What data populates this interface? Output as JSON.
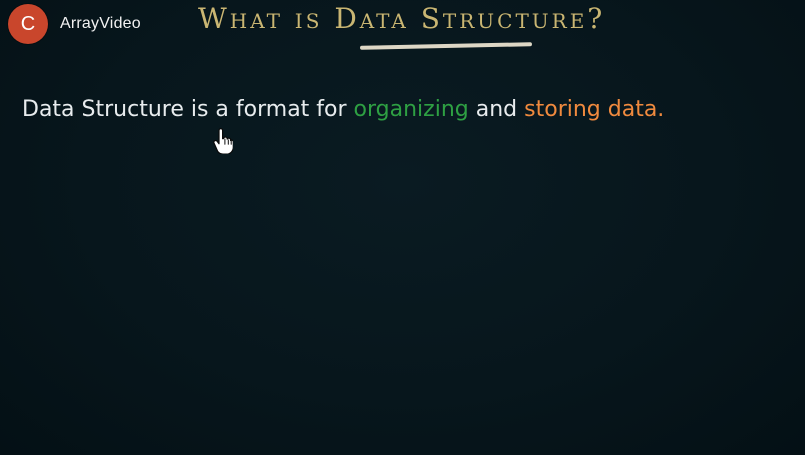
{
  "channel": {
    "avatar_letter": "C",
    "title": "ArrayVideo",
    "avatar_color": "#c9462c"
  },
  "slide": {
    "title": "What is Data Structure?",
    "definition": {
      "part1": "Data Structure is a format for ",
      "highlight1": "organizing",
      "part2": " and ",
      "highlight2": "storing data."
    },
    "colors": {
      "title": "#c9b673",
      "highlight1": "#2ea043",
      "highlight2": "#f08a3e",
      "background": "#06141a"
    }
  },
  "icons": {
    "cursor": "hand-pointer-icon"
  }
}
